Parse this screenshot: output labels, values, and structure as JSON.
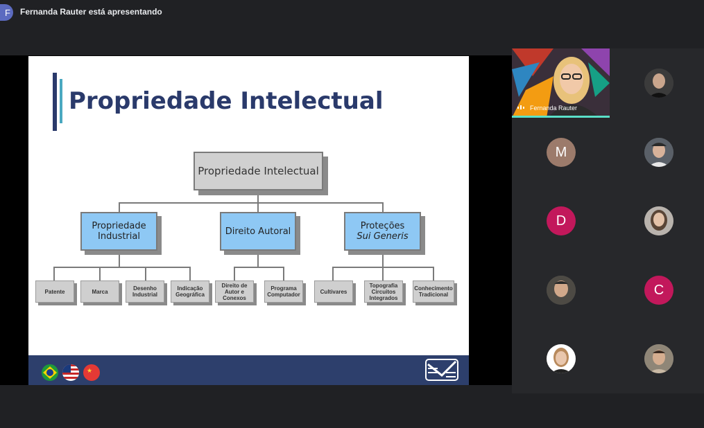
{
  "header": {
    "presenter_initial": "F",
    "presenting_text": "Fernanda Rauter está apresentando"
  },
  "slide": {
    "title": "Propriedade Intelectual",
    "root": "Propriedade Intelectual",
    "branches": [
      {
        "label_line1": "Propriedade",
        "label_line2": "Industrial",
        "leaves": [
          {
            "l1": "Patente",
            "l2": ""
          },
          {
            "l1": "Marca",
            "l2": ""
          },
          {
            "l1": "Desenho",
            "l2": "Industrial"
          },
          {
            "l1": "Indicação",
            "l2": "Geográfica"
          }
        ]
      },
      {
        "label_line1": "Direito Autoral",
        "label_line2": "",
        "leaves": [
          {
            "l1": "Direito de",
            "l2": "Autor e",
            "l3": "Conexos"
          },
          {
            "l1": "Programa",
            "l2": "Computador"
          }
        ]
      },
      {
        "label_line1": "Proteções",
        "label_line2": "Sui Generis",
        "leaves": [
          {
            "l1": "Cultivares",
            "l2": ""
          },
          {
            "l1": "Topografia",
            "l2": "Circuitos",
            "l3": "Integrados"
          },
          {
            "l1": "Conhecimento",
            "l2": "Tradicional"
          }
        ]
      }
    ],
    "footer_flags": [
      "brazil-flag",
      "usa-flag",
      "china-flag"
    ]
  },
  "participants": {
    "presenter_name": "Fernanda Rauter",
    "initials": [
      "M",
      "D",
      "C"
    ],
    "colors": {
      "M": "#9c7b6b",
      "D": "#c2185b",
      "C": "#c2185b"
    }
  }
}
